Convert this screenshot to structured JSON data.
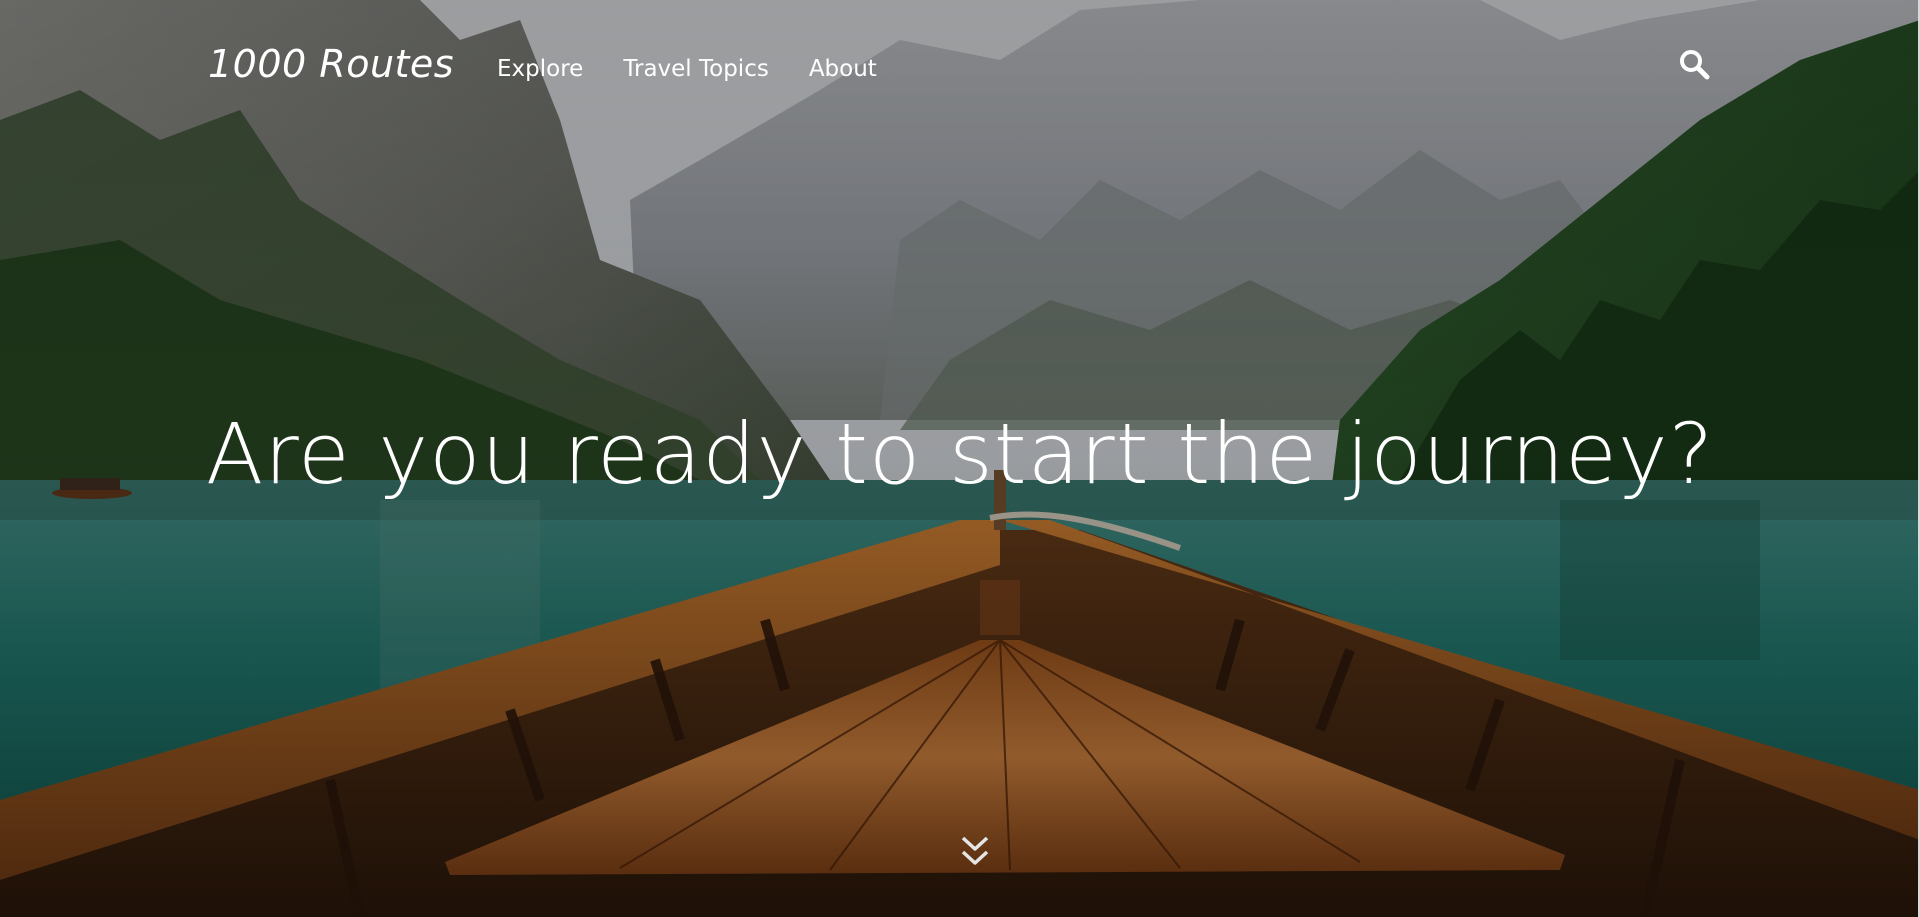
{
  "site": {
    "brand": "1000 Routes"
  },
  "nav": {
    "items": [
      {
        "label": "Explore"
      },
      {
        "label": "Travel Topics"
      },
      {
        "label": "About"
      }
    ],
    "search_icon": "search-icon"
  },
  "hero": {
    "headline": "Are you ready to start the journey?",
    "scroll_icon": "double-chevron-down-icon"
  }
}
